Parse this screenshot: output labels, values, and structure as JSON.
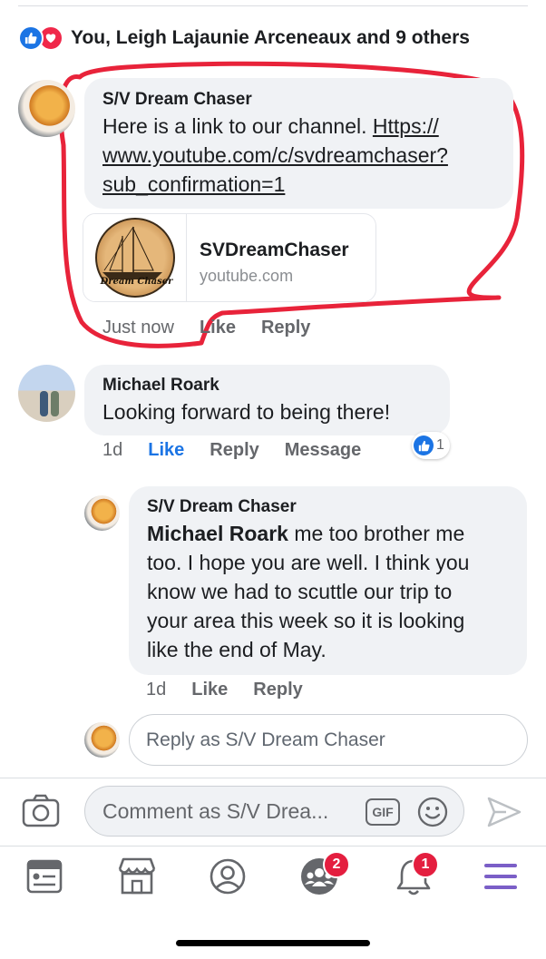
{
  "reactions": {
    "text": "You, Leigh Lajaunie Arceneaux and 9 others"
  },
  "comment1": {
    "author": "S/V Dream Chaser",
    "text_lines": [
      "Here is a link to our channel. ",
      "Https://",
      "www.youtube.com/c/svdreamchaser?",
      "sub_confirmation=1"
    ],
    "preview": {
      "title": "SVDreamChaser",
      "domain": "youtube.com",
      "logo_text": "Dream Chaser"
    },
    "time": "Just now",
    "like": "Like",
    "reply": "Reply"
  },
  "comment2": {
    "author": "Michael Roark",
    "text": "Looking forward to being there!",
    "time": "1d",
    "like": "Like",
    "reply": "Reply",
    "message": "Message",
    "like_count": "1"
  },
  "reply1": {
    "author": "S/V Dream Chaser",
    "mention": "Michael Roark",
    "line1_rest": " me too brother me",
    "lines": [
      "too. I hope you are well. I think you",
      "know we had to scuttle our trip to",
      "your area this week so it is looking",
      "like the end of May."
    ],
    "time": "1d",
    "like": "Like",
    "reply": "Reply"
  },
  "reply_input": {
    "placeholder": "Reply as S/V Dream Chaser"
  },
  "composer": {
    "placeholder": "Comment as S/V Drea...",
    "gif_label": "GIF"
  },
  "tabbar": {
    "items": [
      {
        "icon": "news-feed-icon"
      },
      {
        "icon": "marketplace-icon"
      },
      {
        "icon": "profile-icon"
      },
      {
        "icon": "groups-icon",
        "badge": "2"
      },
      {
        "icon": "notifications-icon",
        "badge": "1"
      },
      {
        "icon": "menu-icon"
      }
    ]
  },
  "colors": {
    "accent": "#1b74e4",
    "love": "#f0284a",
    "badge": "#e41e3f",
    "annotation": "#e8233a",
    "menu": "#7b5fc7"
  }
}
